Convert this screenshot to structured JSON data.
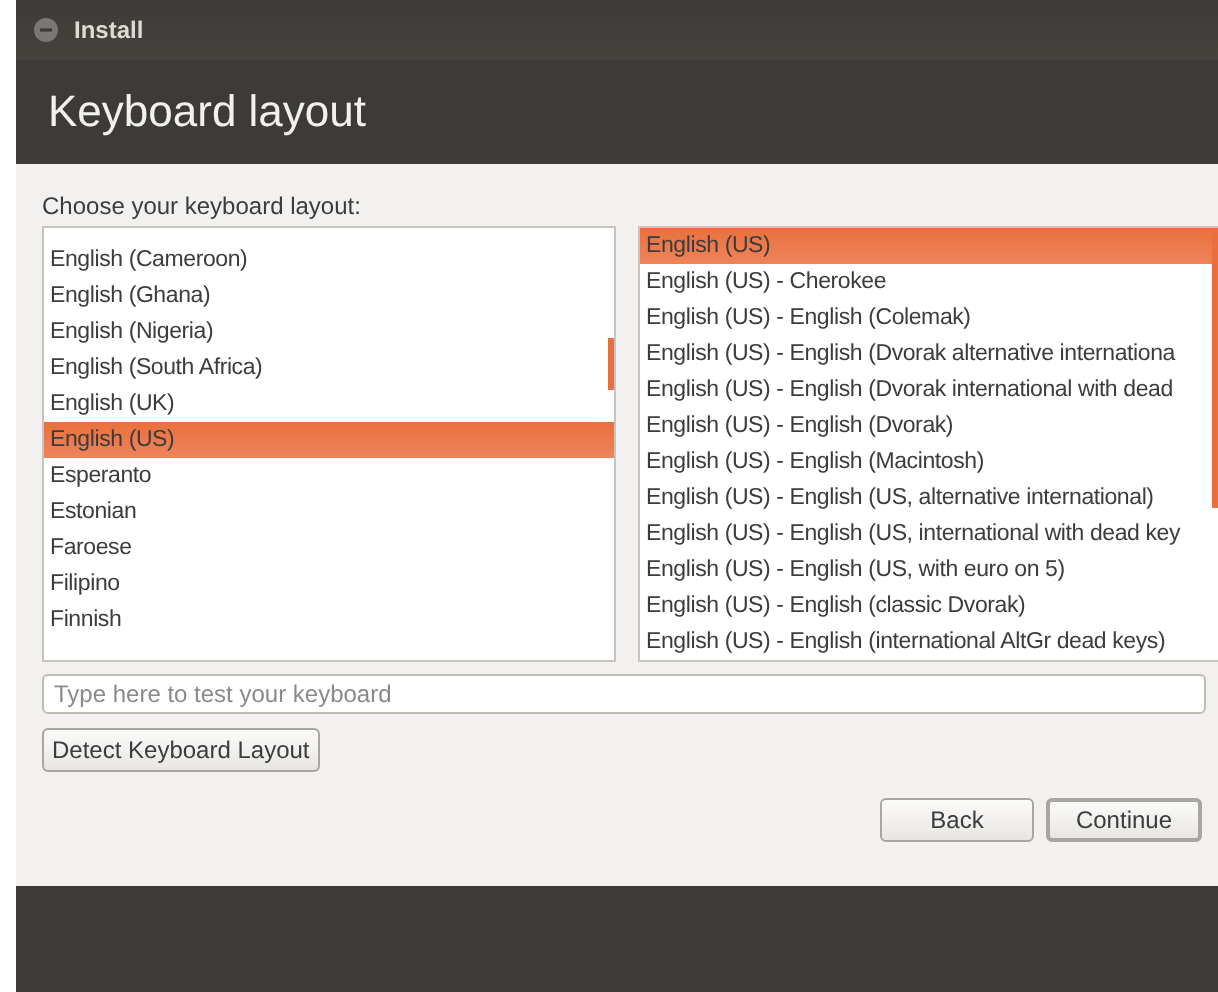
{
  "window": {
    "title": "Install"
  },
  "heading": "Keyboard layout",
  "prompt": "Choose your keyboard layout:",
  "layouts": [
    {
      "label": "English (Cameroon)",
      "selected": false
    },
    {
      "label": "English (Ghana)",
      "selected": false
    },
    {
      "label": "English (Nigeria)",
      "selected": false
    },
    {
      "label": "English (South Africa)",
      "selected": false
    },
    {
      "label": "English (UK)",
      "selected": false
    },
    {
      "label": "English (US)",
      "selected": true
    },
    {
      "label": "Esperanto",
      "selected": false
    },
    {
      "label": "Estonian",
      "selected": false
    },
    {
      "label": "Faroese",
      "selected": false
    },
    {
      "label": "Filipino",
      "selected": false
    },
    {
      "label": "Finnish",
      "selected": false
    }
  ],
  "variants": [
    {
      "label": "English (US)",
      "selected": true
    },
    {
      "label": "English (US) - Cherokee",
      "selected": false
    },
    {
      "label": "English (US) - English (Colemak)",
      "selected": false
    },
    {
      "label": "English (US) - English (Dvorak alternative internationa",
      "selected": false
    },
    {
      "label": "English (US) - English (Dvorak international with dead",
      "selected": false
    },
    {
      "label": "English (US) - English (Dvorak)",
      "selected": false
    },
    {
      "label": "English (US) - English (Macintosh)",
      "selected": false
    },
    {
      "label": "English (US) - English (US, alternative international)",
      "selected": false
    },
    {
      "label": "English (US) - English (US, international with dead key",
      "selected": false
    },
    {
      "label": "English (US) - English (US, with euro on 5)",
      "selected": false
    },
    {
      "label": "English (US) - English (classic Dvorak)",
      "selected": false
    },
    {
      "label": "English (US) - English (international AltGr dead keys)",
      "selected": false
    }
  ],
  "test_field": {
    "placeholder": "Type here to test your keyboard"
  },
  "detect_button": "Detect Keyboard Layout",
  "buttons": [
    {
      "label": "Back",
      "kind": "normal"
    },
    {
      "label": "Continue",
      "kind": "default"
    }
  ]
}
